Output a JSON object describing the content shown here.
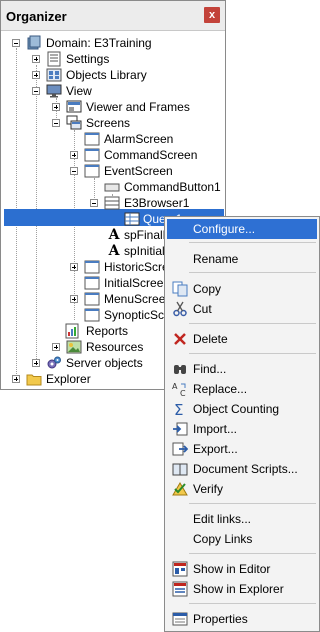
{
  "organizer": {
    "title": "Organizer",
    "close_glyph": "x",
    "tree": {
      "domain": "Domain: E3Training",
      "settings": "Settings",
      "objects_library": "Objects Library",
      "view": "View",
      "viewer_and_frames": "Viewer and Frames",
      "screens": "Screens",
      "alarm_screen": "AlarmScreen",
      "command_screen": "CommandScreen",
      "event_screen": "EventScreen",
      "command_button": "CommandButton1",
      "e3browser": "E3Browser1",
      "query": "Query1",
      "sp_final": "spFinalD",
      "sp_initial": "spInitialD",
      "historic_screen": "HistoricScreen",
      "initial_screen": "InitialScreen",
      "menu_screen": "MenuScreen",
      "synoptic_screen": "SynopticScreen",
      "reports": "Reports",
      "resources": "Resources",
      "server_objects": "Server objects",
      "explorer": "Explorer"
    }
  },
  "context_menu": {
    "configure": "Configure...",
    "rename": "Rename",
    "copy": "Copy",
    "cut": "Cut",
    "delete": "Delete",
    "find": "Find...",
    "replace": "Replace...",
    "object_counting": "Object Counting",
    "import": "Import...",
    "export": "Export...",
    "document_scripts": "Document Scripts...",
    "verify": "Verify",
    "edit_links": "Edit links...",
    "copy_links": "Copy Links",
    "show_in_editor": "Show in Editor",
    "show_in_explorer": "Show in Explorer",
    "properties": "Properties"
  },
  "colors": {
    "selection": "#2e70d3",
    "close_button": "#c3433a",
    "menu_background": "#f3f3f3"
  }
}
